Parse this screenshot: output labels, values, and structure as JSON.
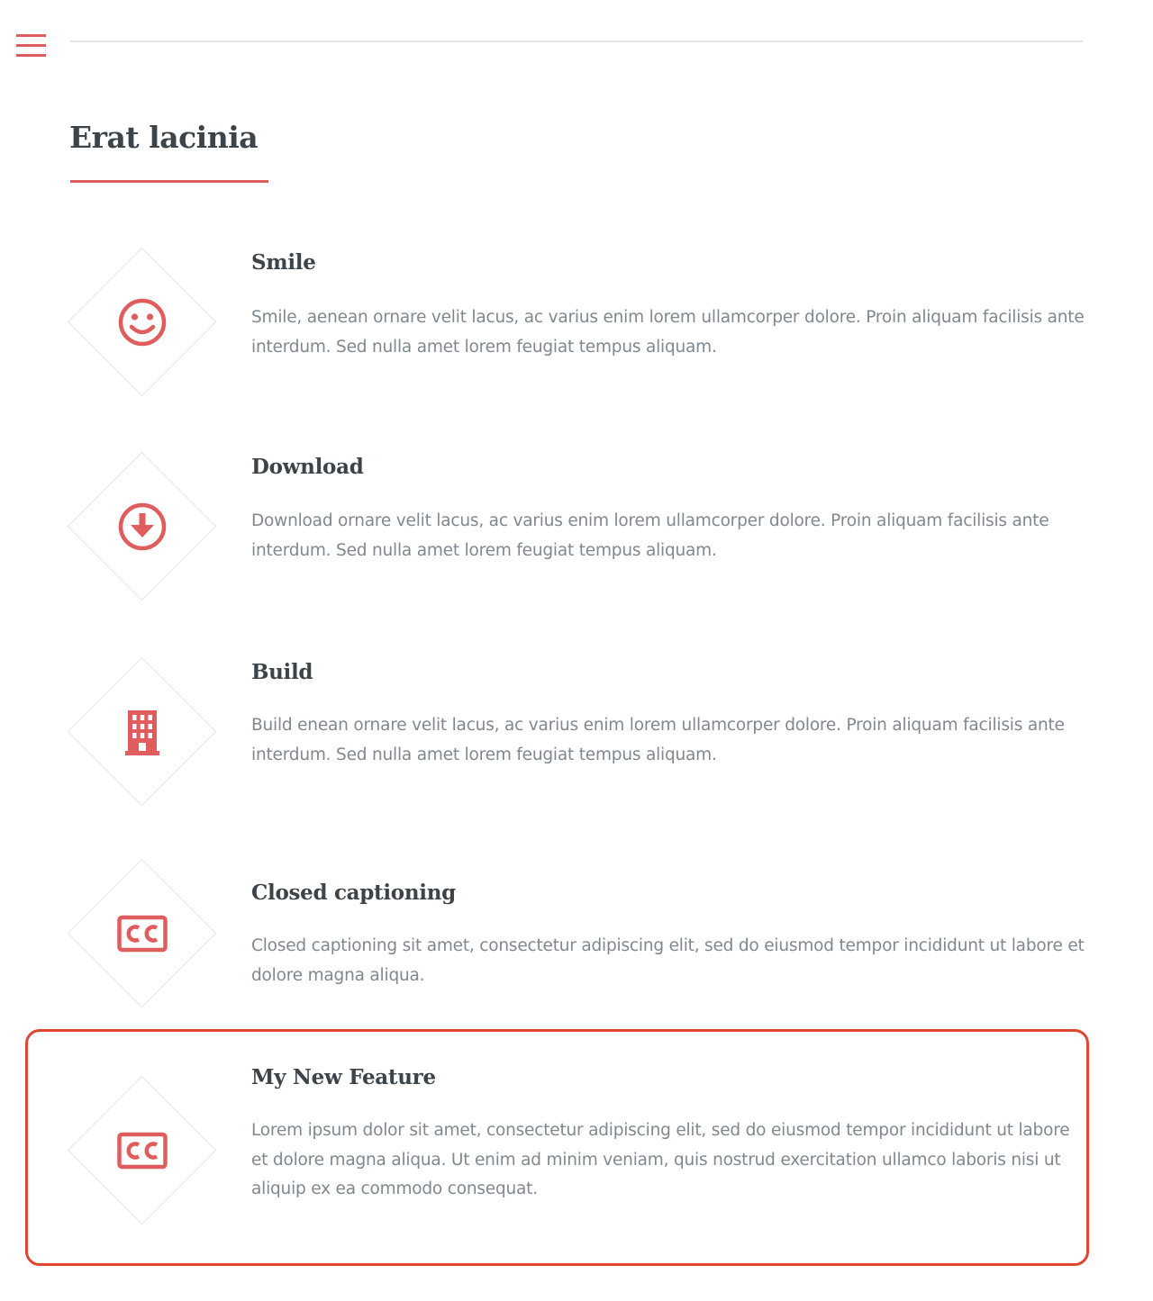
{
  "nav": {
    "menu_icon": "hamburger-icon",
    "accent_color": "#e05d5d"
  },
  "section": {
    "title": "Erat lacinia"
  },
  "features": [
    {
      "icon": "smile-icon",
      "title": "Smile",
      "description": "Smile, aenean ornare velit lacus, ac varius enim lorem ullamcorper dolore. Proin aliquam facilisis ante interdum. Sed nulla amet lorem feugiat tempus aliquam."
    },
    {
      "icon": "download-icon",
      "title": "Download",
      "description": "Download ornare velit lacus, ac varius enim lorem ullamcorper dolore. Proin aliquam facilisis ante interdum. Sed nulla amet lorem feugiat tempus aliquam."
    },
    {
      "icon": "building-icon",
      "title": "Build",
      "description": "Build enean ornare velit lacus, ac varius enim lorem ullamcorper dolore. Proin aliquam facilisis ante interdum. Sed nulla amet lorem feugiat tempus aliquam."
    },
    {
      "icon": "closed-captioning-icon",
      "title": "Closed captioning",
      "description": "Closed captioning sit amet, consectetur adipiscing elit, sed do eiusmod tempor incididunt ut labore et dolore magna aliqua."
    },
    {
      "icon": "closed-captioning-icon",
      "title": "My New Feature",
      "description": "Lorem ipsum dolor sit amet, consectetur adipiscing elit, sed do eiusmod tempor incididunt ut labore et dolore magna aliqua. Ut enim ad minim veniam, quis nostrud exercitation ullamco laboris nisi ut aliquip ex ea commodo consequat.",
      "highlighted": true,
      "highlight_color": "#e0452f"
    }
  ]
}
